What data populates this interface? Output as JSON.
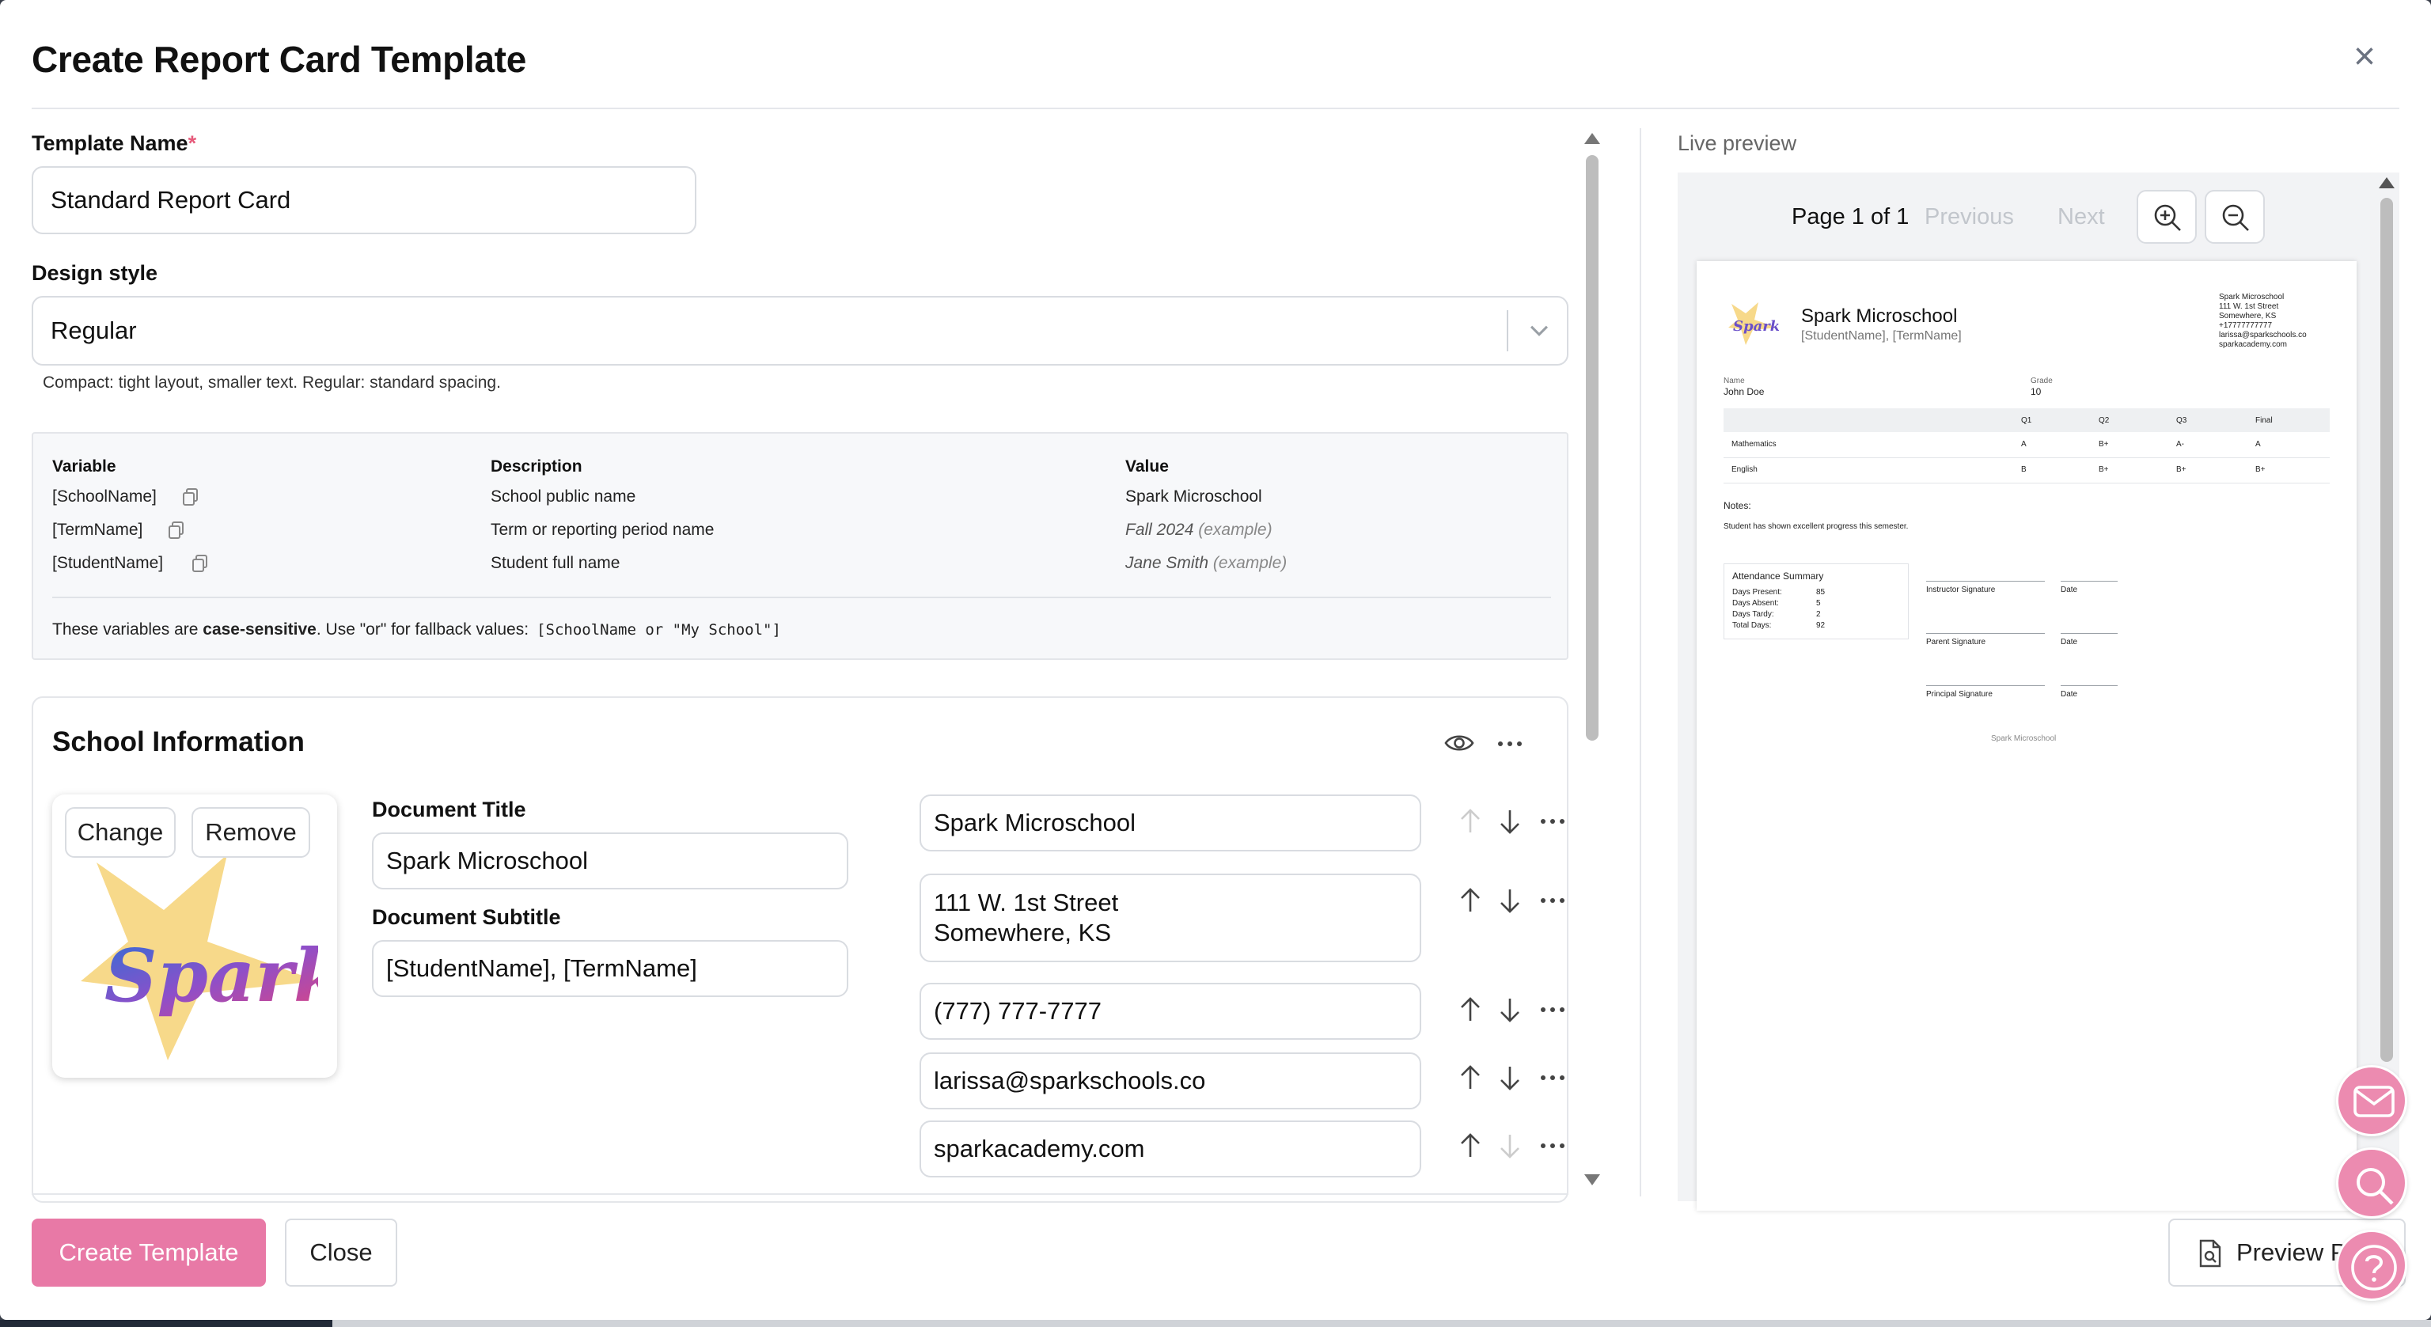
{
  "modal": {
    "title": "Create Report Card Template"
  },
  "form": {
    "template_name_label": "Template Name",
    "required_mark": "*",
    "template_name_value": "Standard Report Card",
    "design_style_label": "Design style",
    "design_style_value": "Regular",
    "design_style_hint": "Compact: tight layout, smaller text. Regular: standard spacing."
  },
  "variables": {
    "headers": {
      "variable": "Variable",
      "description": "Description",
      "value": "Value"
    },
    "rows": [
      {
        "name": "[SchoolName]",
        "description": "School public name",
        "value": "Spark Microschool",
        "example": ""
      },
      {
        "name": "[TermName]",
        "description": "Term or reporting period name",
        "value": "Fall 2024",
        "example": "(example)"
      },
      {
        "name": "[StudentName]",
        "description": "Student full name",
        "value": "Jane Smith",
        "example": "(example)"
      }
    ],
    "note_prefix": "These variables are ",
    "note_bold": "case-sensitive",
    "note_suffix": ". Use \"or\" for fallback values:",
    "note_code": "[SchoolName or \"My School\"]"
  },
  "school_info": {
    "title": "School Information",
    "change_label": "Change",
    "remove_label": "Remove",
    "logo_text": "Spark",
    "doc_title_label": "Document Title",
    "doc_title_value": "Spark Microschool",
    "doc_subtitle_label": "Document Subtitle",
    "doc_subtitle_value": "[StudentName], [TermName]",
    "fields": [
      "Spark Microschool",
      "111 W. 1st Street\nSomewhere, KS",
      "(777) 777-7777",
      "larissa@sparkschools.co",
      "sparkacademy.com"
    ]
  },
  "preview": {
    "label": "Live preview",
    "page_info": "Page 1 of 1",
    "previous": "Previous",
    "next": "Next",
    "paper": {
      "school": "Spark Microschool",
      "subtitle": "[StudentName], [TermName]",
      "address": [
        "Spark Microschool",
        "111 W. 1st Street",
        "Somewhere, KS",
        "+17777777777",
        "larissa@sparkschools.co",
        "sparkacademy.com"
      ],
      "name_label": "Name",
      "name_value": "John Doe",
      "grade_label": "Grade",
      "grade_value": "10",
      "table_headers": [
        "Q1",
        "Q2",
        "Q3",
        "Final"
      ],
      "table_rows": [
        {
          "subject": "Mathematics",
          "grades": [
            "A",
            "B+",
            "A-",
            "A"
          ]
        },
        {
          "subject": "English",
          "grades": [
            "B",
            "B+",
            "B+",
            "B+"
          ]
        }
      ],
      "notes_label": "Notes:",
      "notes_text": "Student has shown excellent progress this semester.",
      "attendance_title": "Attendance Summary",
      "attendance": [
        {
          "label": "Days Present:",
          "value": "85"
        },
        {
          "label": "Days Absent:",
          "value": "5"
        },
        {
          "label": "Days Tardy:",
          "value": "2"
        },
        {
          "label": "Total Days:",
          "value": "92"
        }
      ],
      "signatures": [
        "Instructor Signature",
        "Parent Signature",
        "Principal Signature"
      ],
      "date_label": "Date",
      "footer": "Spark Microschool"
    }
  },
  "footer": {
    "create_label": "Create Template",
    "close_label": "Close",
    "preview_label": "Preview P"
  },
  "colors": {
    "primary": "#e879a6",
    "fab": "#ec8bb0"
  }
}
